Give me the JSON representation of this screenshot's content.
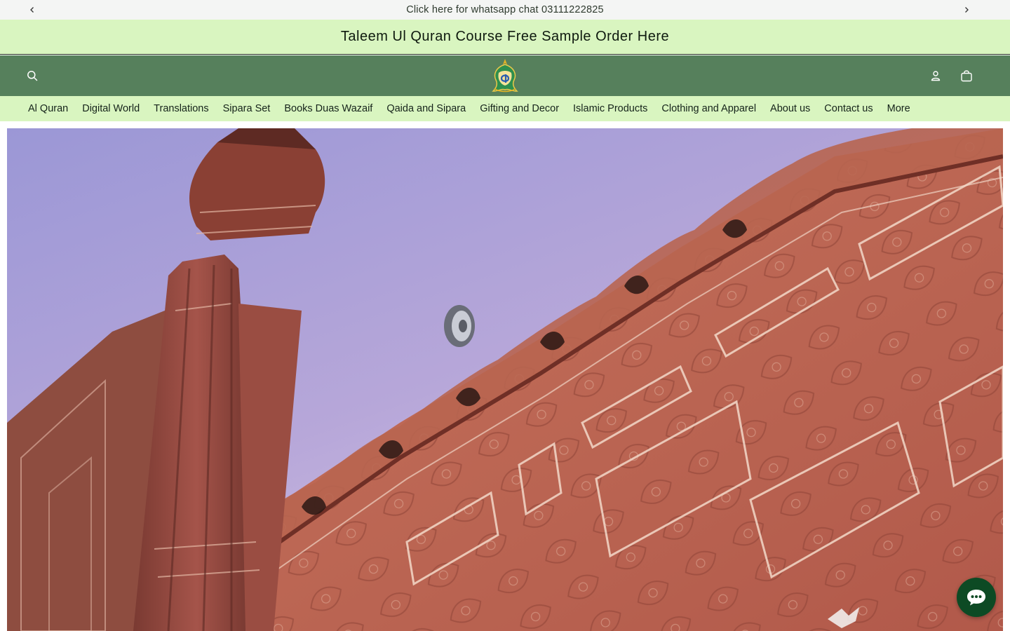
{
  "announcement": {
    "text": "Click here for whatsapp chat 03111222825",
    "prev_icon": "chevron-left-icon",
    "next_icon": "chevron-right-icon"
  },
  "promo": {
    "text": "Taleem Ul Quran Course Free Sample Order Here"
  },
  "header": {
    "search_icon": "search-icon",
    "logo_icon": "store-logo-icon",
    "account_icon": "account-icon",
    "cart_icon": "cart-icon"
  },
  "nav": {
    "items": [
      {
        "label": "Al Quran"
      },
      {
        "label": "Digital World"
      },
      {
        "label": "Translations"
      },
      {
        "label": "Sipara Set"
      },
      {
        "label": "Books Duas Wazaif"
      },
      {
        "label": "Qaida and Sipara"
      },
      {
        "label": "Gifting and Decor"
      },
      {
        "label": "Islamic Products"
      },
      {
        "label": "Clothing and Apparel"
      },
      {
        "label": "About us"
      },
      {
        "label": "Contact us"
      },
      {
        "label": "More"
      }
    ]
  },
  "colors": {
    "header_green": "#56805c",
    "promo_green": "#d9f5c0",
    "chat_button": "#0d4a24"
  },
  "chat": {
    "icon": "chat-bubble-icon"
  }
}
